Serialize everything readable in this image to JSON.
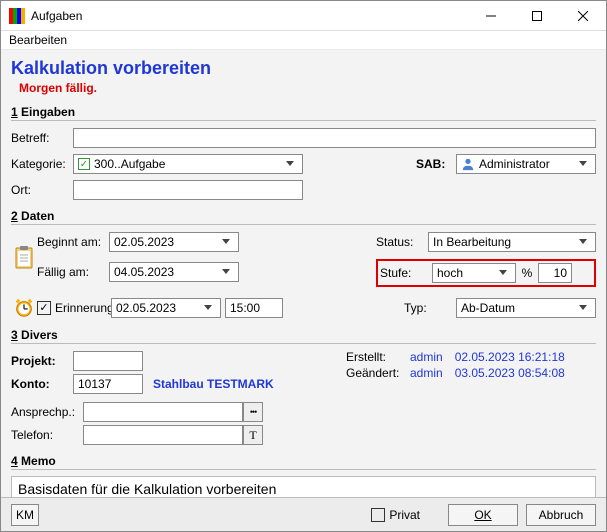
{
  "window": {
    "title": "Aufgaben"
  },
  "menu": {
    "edit": "Bearbeiten"
  },
  "header": {
    "title": "Kalkulation vorbereiten",
    "due": "Morgen fällig."
  },
  "sections": {
    "eingaben_num": "1",
    "eingaben": " Eingaben",
    "daten_num": "2",
    "daten": " Daten",
    "divers_num": "3",
    "divers": " Divers",
    "memo_num": "4",
    "memo": " Memo"
  },
  "labels": {
    "betreff": "Betreff:",
    "kategorie": "Kategorie:",
    "ort": "Ort:",
    "sab": "SAB:",
    "beginnt": "Beginnt am:",
    "faellig": "Fällig am:",
    "status": "Status:",
    "stufe": "Stufe:",
    "pct": "%",
    "erinnerung": "Erinnerung",
    "typ": "Typ:",
    "projekt": "Projekt:",
    "konto": "Konto:",
    "ansprech": "Ansprechp.:",
    "telefon": "Telefon:",
    "erstellt": "Erstellt:",
    "geaendert": "Geändert:",
    "privat": "Privat",
    "ok": "OK",
    "abbruch": "Abbruch",
    "km": "KM",
    "t": "T",
    "dots": "▪▪▪"
  },
  "fields": {
    "betreff": "Kalkulation vorbereiten",
    "kategorie": "300..Aufgabe",
    "ort": "",
    "sab": "Administrator",
    "beginnt": "02.05.2023",
    "faellig": "04.05.2023",
    "status": "In Bearbeitung",
    "stufe": "hoch",
    "pct_val": "10",
    "erinnerung_checked": true,
    "erin_date": "02.05.2023",
    "erin_time": "15:00",
    "typ": "Ab-Datum",
    "projekt": "",
    "konto": "10137",
    "konto_name": "Stahlbau TESTMARK",
    "ansprech": "",
    "telefon": ""
  },
  "audit": {
    "created_by": "admin",
    "created_at": "02.05.2023 16:21:18",
    "changed_by": "admin",
    "changed_at": "03.05.2023 08:54:08"
  },
  "memo": {
    "text": "Basisdaten für die Kalkulation vorbereiten"
  }
}
